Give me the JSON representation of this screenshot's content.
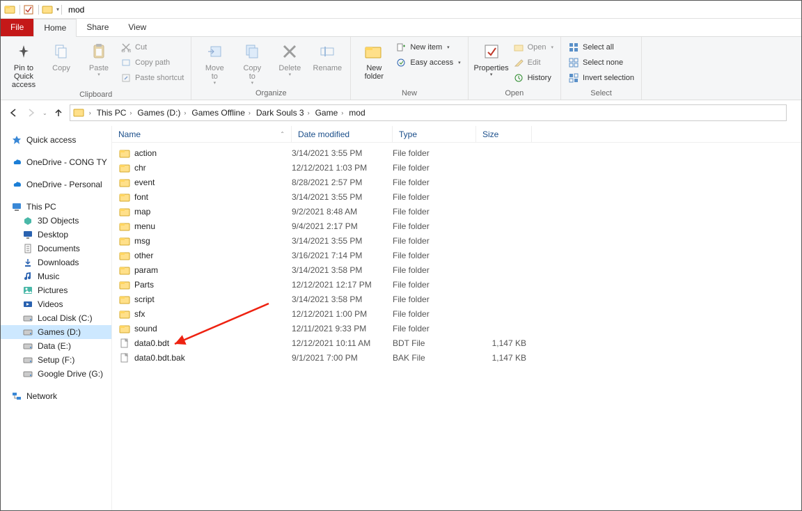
{
  "title": "mod",
  "tabs": {
    "file": "File",
    "home": "Home",
    "share": "Share",
    "view": "View"
  },
  "ribbon": {
    "pin": "Pin to Quick\naccess",
    "copy": "Copy",
    "paste": "Paste",
    "cut": "Cut",
    "copy_path": "Copy path",
    "paste_shortcut": "Paste shortcut",
    "clipboard_group": "Clipboard",
    "move_to": "Move\nto",
    "copy_to": "Copy\nto",
    "delete": "Delete",
    "rename": "Rename",
    "organize_group": "Organize",
    "new_folder": "New\nfolder",
    "new_item": "New item",
    "easy_access": "Easy access",
    "new_group": "New",
    "properties": "Properties",
    "open": "Open",
    "edit": "Edit",
    "history": "History",
    "open_group": "Open",
    "select_all": "Select all",
    "select_none": "Select none",
    "invert_selection": "Invert selection",
    "select_group": "Select"
  },
  "breadcrumb": [
    "This PC",
    "Games (D:)",
    "Games Offline",
    "Dark Souls 3",
    "Game",
    "mod"
  ],
  "columns": {
    "name": "Name",
    "date": "Date modified",
    "type": "Type",
    "size": "Size"
  },
  "sidebar": {
    "quick_access": "Quick access",
    "onedrive1": "OneDrive - CONG TY",
    "onedrive2": "OneDrive - Personal",
    "this_pc": "This PC",
    "objects3d": "3D Objects",
    "desktop": "Desktop",
    "documents": "Documents",
    "downloads": "Downloads",
    "music": "Music",
    "pictures": "Pictures",
    "videos": "Videos",
    "local_disk": "Local Disk (C:)",
    "games": "Games (D:)",
    "data": "Data (E:)",
    "setup": "Setup (F:)",
    "gdrive": "Google Drive (G:)",
    "network": "Network"
  },
  "files": [
    {
      "name": "action",
      "date": "3/14/2021 3:55 PM",
      "type": "File folder",
      "size": "",
      "kind": "folder"
    },
    {
      "name": "chr",
      "date": "12/12/2021 1:03 PM",
      "type": "File folder",
      "size": "",
      "kind": "folder"
    },
    {
      "name": "event",
      "date": "8/28/2021 2:57 PM",
      "type": "File folder",
      "size": "",
      "kind": "folder"
    },
    {
      "name": "font",
      "date": "3/14/2021 3:55 PM",
      "type": "File folder",
      "size": "",
      "kind": "folder"
    },
    {
      "name": "map",
      "date": "9/2/2021 8:48 AM",
      "type": "File folder",
      "size": "",
      "kind": "folder"
    },
    {
      "name": "menu",
      "date": "9/4/2021 2:17 PM",
      "type": "File folder",
      "size": "",
      "kind": "folder"
    },
    {
      "name": "msg",
      "date": "3/14/2021 3:55 PM",
      "type": "File folder",
      "size": "",
      "kind": "folder"
    },
    {
      "name": "other",
      "date": "3/16/2021 7:14 PM",
      "type": "File folder",
      "size": "",
      "kind": "folder"
    },
    {
      "name": "param",
      "date": "3/14/2021 3:58 PM",
      "type": "File folder",
      "size": "",
      "kind": "folder"
    },
    {
      "name": "Parts",
      "date": "12/12/2021 12:17 PM",
      "type": "File folder",
      "size": "",
      "kind": "folder"
    },
    {
      "name": "script",
      "date": "3/14/2021 3:58 PM",
      "type": "File folder",
      "size": "",
      "kind": "folder"
    },
    {
      "name": "sfx",
      "date": "12/12/2021 1:00 PM",
      "type": "File folder",
      "size": "",
      "kind": "folder"
    },
    {
      "name": "sound",
      "date": "12/11/2021 9:33 PM",
      "type": "File folder",
      "size": "",
      "kind": "folder"
    },
    {
      "name": "data0.bdt",
      "date": "12/12/2021 10:11 AM",
      "type": "BDT File",
      "size": "1,147 KB",
      "kind": "file"
    },
    {
      "name": "data0.bdt.bak",
      "date": "9/1/2021 7:00 PM",
      "type": "BAK File",
      "size": "1,147 KB",
      "kind": "file"
    }
  ]
}
